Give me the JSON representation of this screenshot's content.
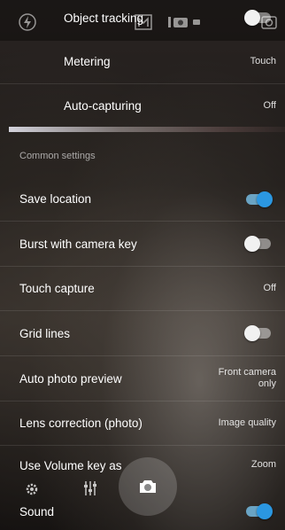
{
  "top_bar": {
    "flash_icon": "flash-auto-icon",
    "mode_icon": "manual-mode-icon",
    "camera_icon": "camera-scene-icon",
    "switch_icon": "switch-camera-icon"
  },
  "rows": {
    "object_tracking": {
      "label": "Object tracking",
      "toggle_on": false
    },
    "metering": {
      "label": "Metering",
      "value": "Touch"
    },
    "auto_capturing": {
      "label": "Auto-capturing",
      "value": "Off"
    },
    "section_header": "Common settings",
    "save_location": {
      "label": "Save location",
      "toggle_on": true
    },
    "burst": {
      "label": "Burst with camera key",
      "toggle_on": false
    },
    "touch_capture": {
      "label": "Touch capture",
      "value": "Off"
    },
    "grid_lines": {
      "label": "Grid lines",
      "toggle_on": false
    },
    "auto_preview": {
      "label": "Auto photo preview",
      "value": "Front camera only"
    },
    "lens_correction": {
      "label": "Lens correction (photo)",
      "value": "Image quality"
    },
    "volume_key": {
      "label": "Use Volume key as",
      "value": "Zoom"
    },
    "sound": {
      "label": "Sound",
      "toggle_on": true
    }
  },
  "bottom_bar": {
    "settings_icon": "settings-icon",
    "filters_icon": "filters-icon",
    "shutter_icon": "camera-shutter-icon"
  },
  "colors": {
    "accent": "#2b97e1",
    "toggle_on_track": "#6aa4c4"
  }
}
